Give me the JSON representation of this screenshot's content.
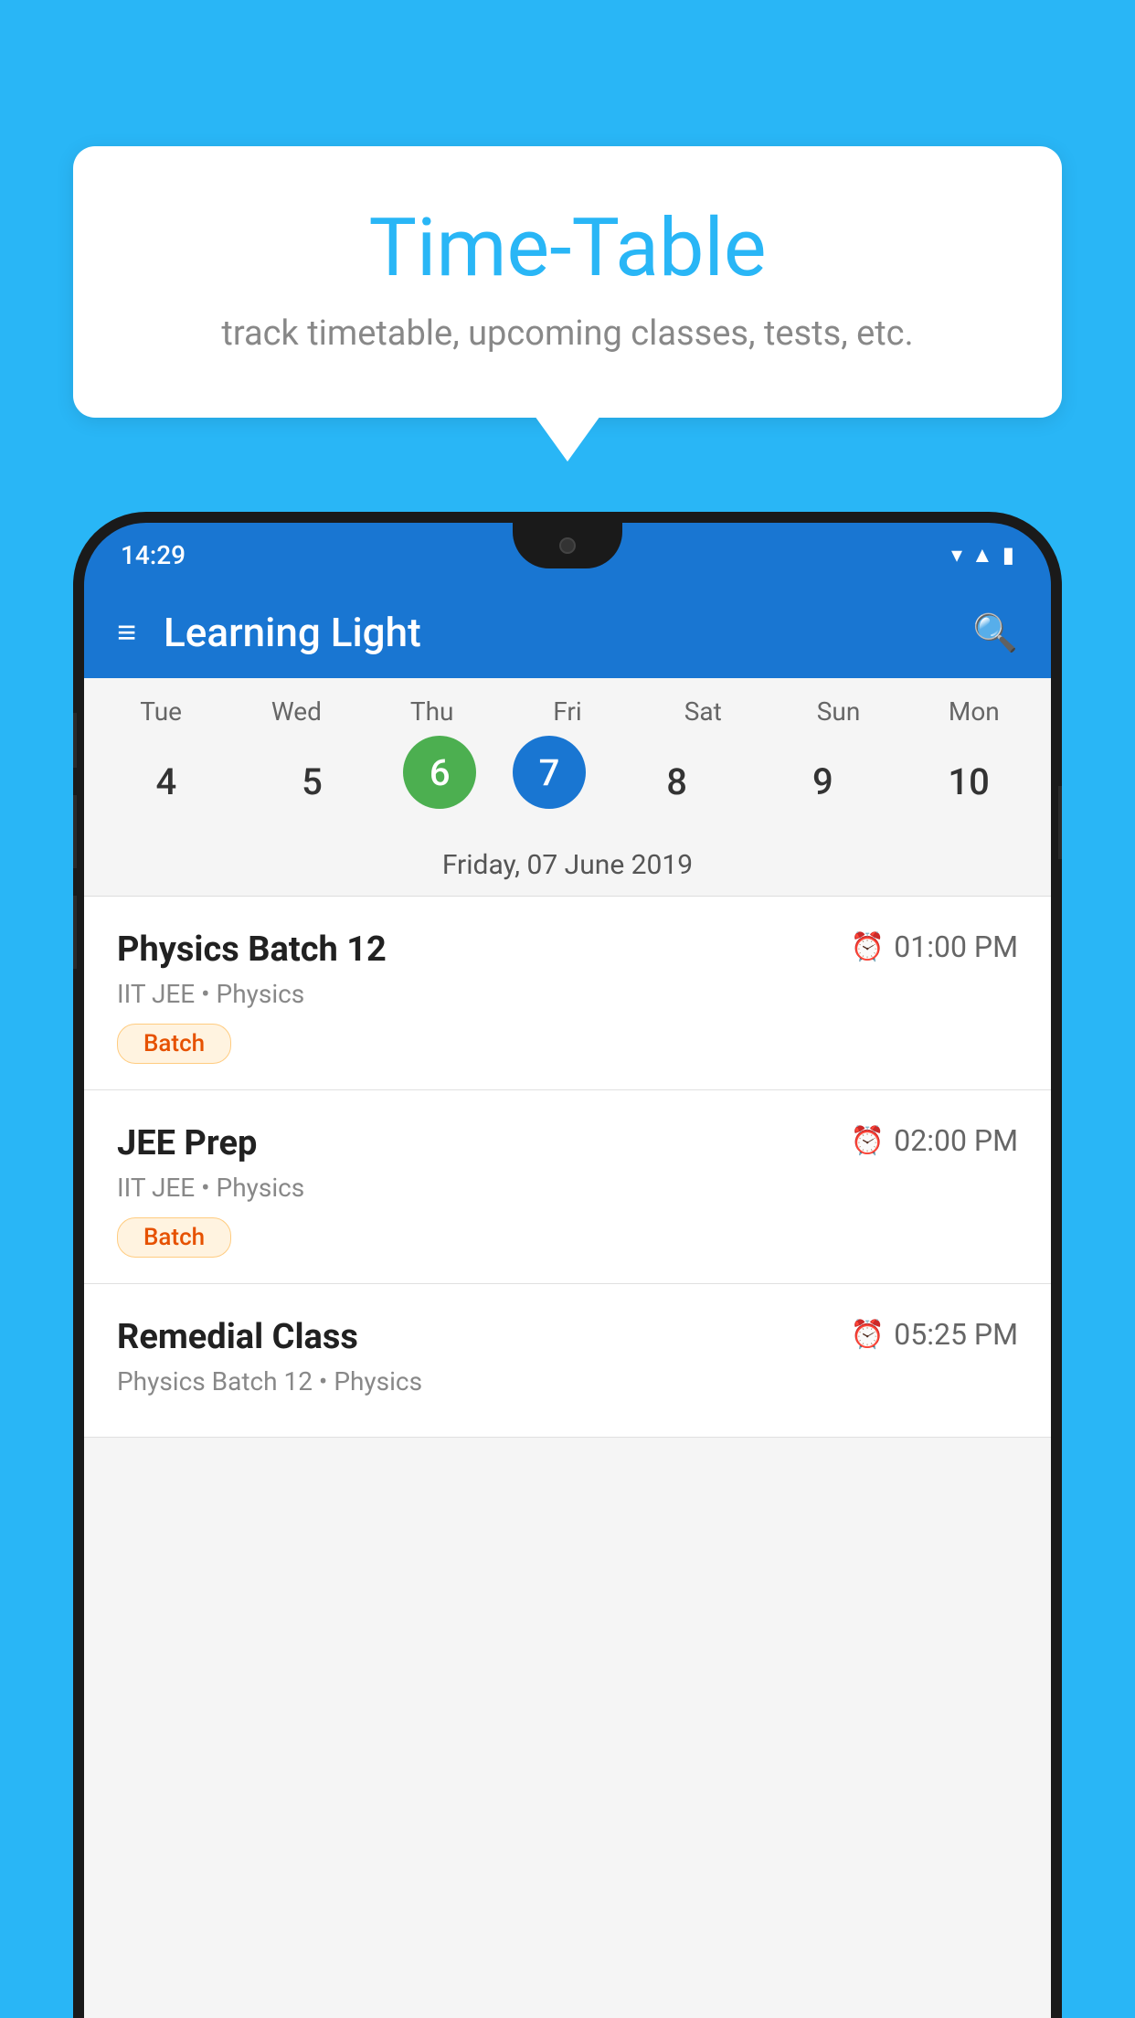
{
  "background_color": "#29b6f6",
  "speech_bubble": {
    "title": "Time-Table",
    "subtitle": "track timetable, upcoming classes, tests, etc."
  },
  "status_bar": {
    "time": "14:29",
    "icons": [
      "wifi",
      "signal",
      "battery"
    ]
  },
  "app_bar": {
    "title": "Learning Light",
    "menu_icon": "≡",
    "search_icon": "🔍"
  },
  "calendar": {
    "days": [
      {
        "label": "Tue",
        "number": "4"
      },
      {
        "label": "Wed",
        "number": "5"
      },
      {
        "label": "Thu",
        "number": "6",
        "state": "today"
      },
      {
        "label": "Fri",
        "number": "7",
        "state": "selected"
      },
      {
        "label": "Sat",
        "number": "8"
      },
      {
        "label": "Sun",
        "number": "9"
      },
      {
        "label": "Mon",
        "number": "10"
      }
    ],
    "selected_date_label": "Friday, 07 June 2019"
  },
  "schedule": [
    {
      "title": "Physics Batch 12",
      "time": "01:00 PM",
      "subtitle": "IIT JEE • Physics",
      "tag": "Batch"
    },
    {
      "title": "JEE Prep",
      "time": "02:00 PM",
      "subtitle": "IIT JEE • Physics",
      "tag": "Batch"
    },
    {
      "title": "Remedial Class",
      "time": "05:25 PM",
      "subtitle": "Physics Batch 12 • Physics",
      "tag": ""
    }
  ]
}
